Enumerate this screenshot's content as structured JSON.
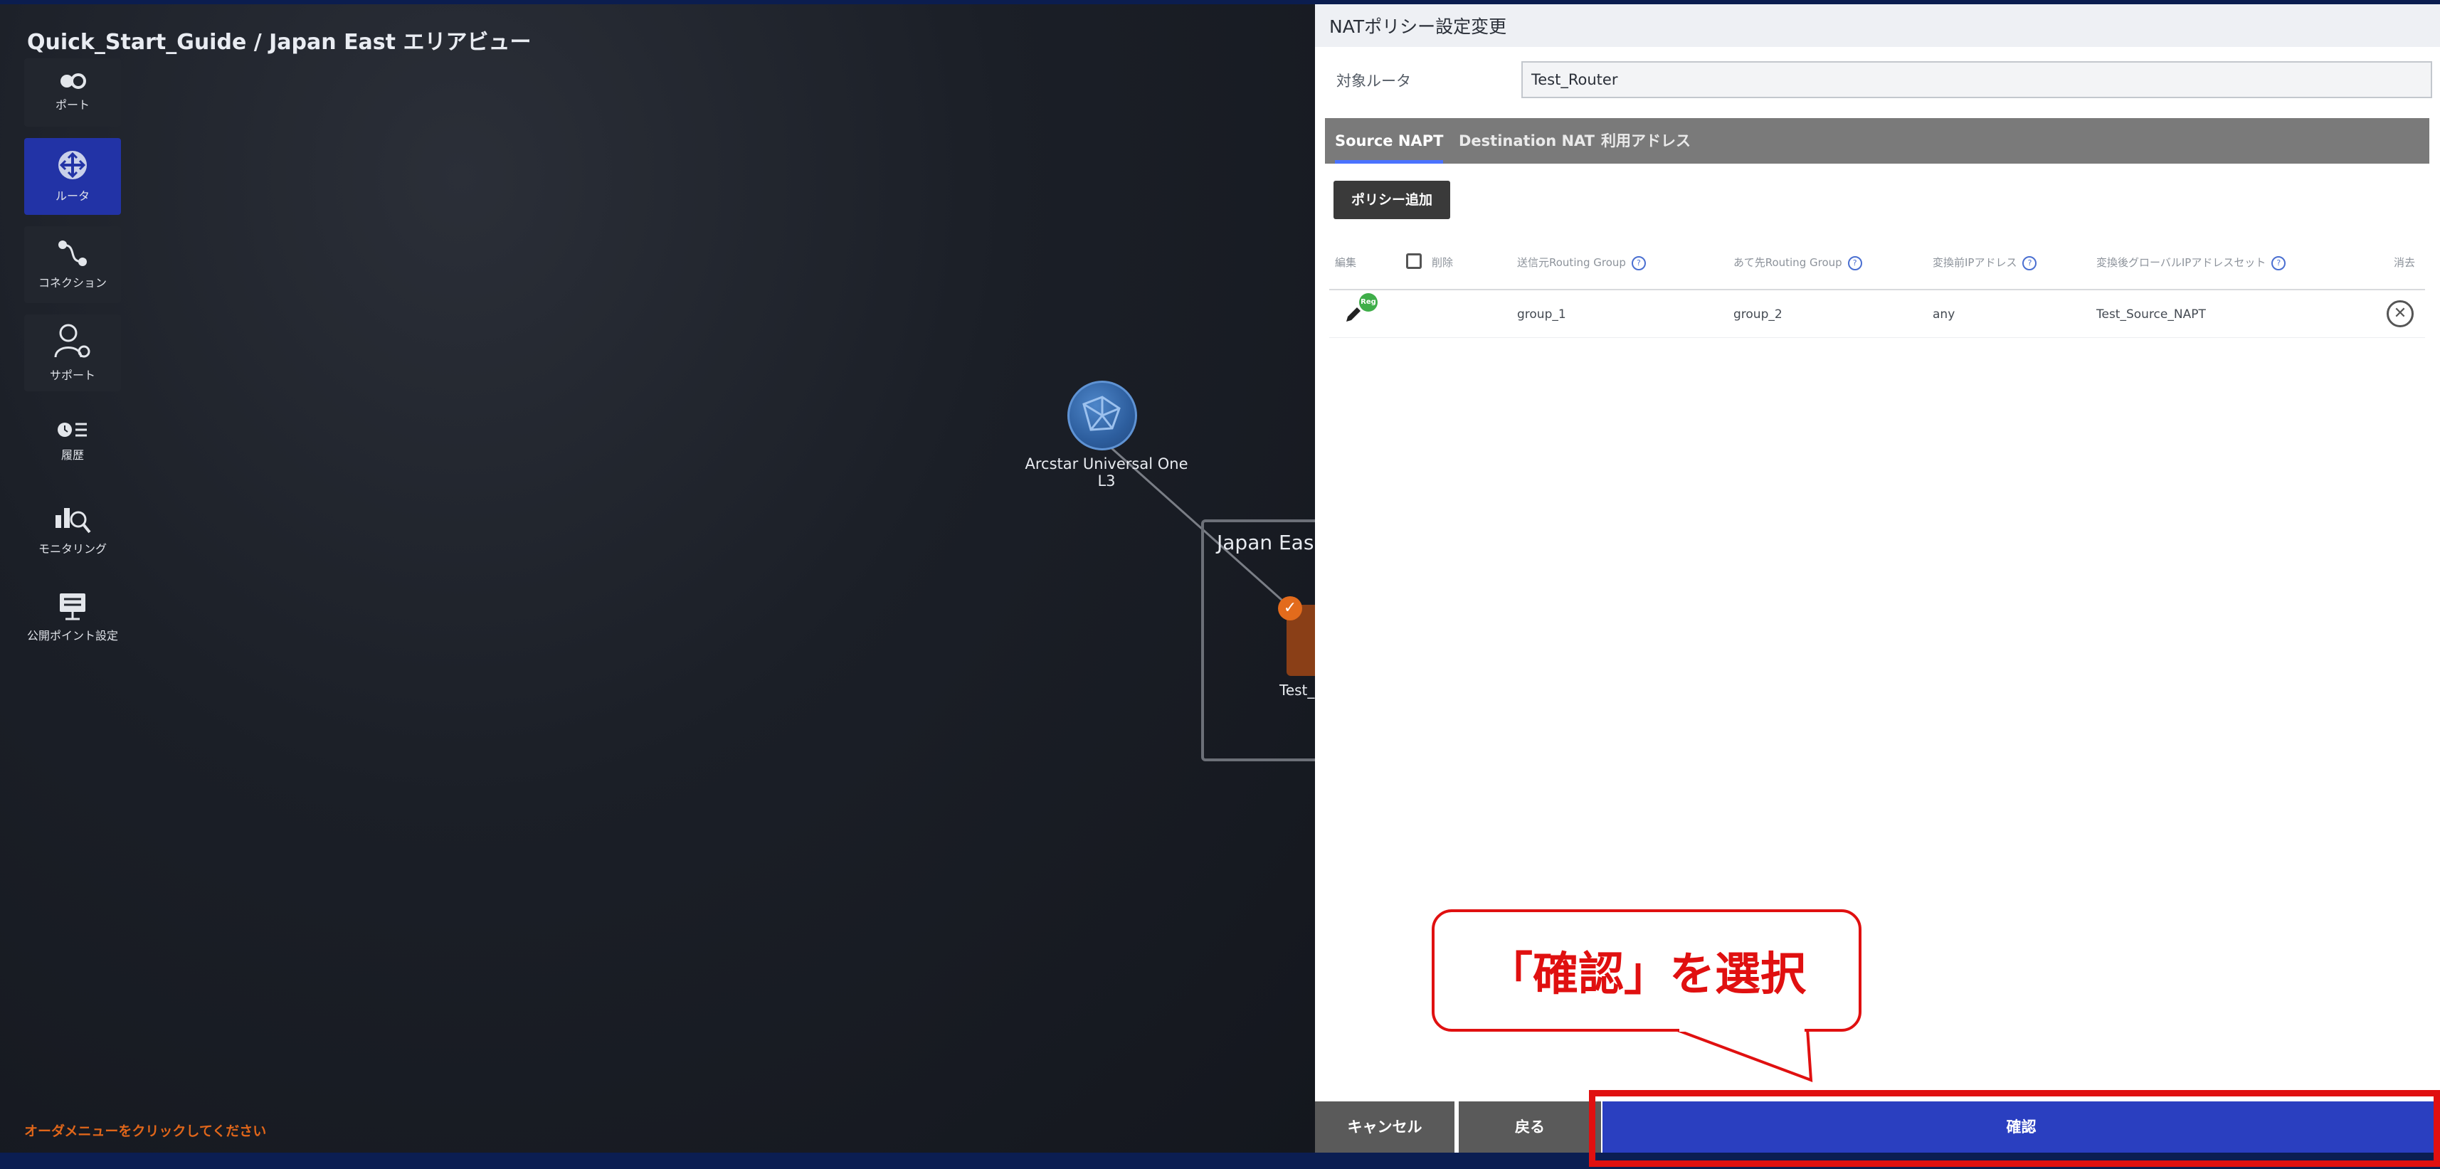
{
  "page_title": "Quick_Start_Guide / Japan East エリアビュー",
  "side_nav": [
    {
      "label": "ポート",
      "icon": "port-icon",
      "active": false
    },
    {
      "label": "ルータ",
      "icon": "router-icon",
      "active": true
    },
    {
      "label": "コネクション",
      "icon": "connection-icon",
      "active": false
    },
    {
      "label": "サポート",
      "icon": "support-icon",
      "active": false
    },
    {
      "label": "履歴",
      "icon": "history-icon",
      "active": false
    },
    {
      "label": "モニタリング",
      "icon": "monitoring-icon",
      "active": false
    },
    {
      "label": "公開ポイント設定",
      "icon": "public-point-icon",
      "active": false
    }
  ],
  "canvas": {
    "cloud_label": "Arcstar Universal One L3",
    "area_label": "Japan Eas",
    "router_label": "Test_"
  },
  "footer_hint": "オーダメニューをクリックしてください",
  "panel": {
    "title": "NATポリシー設定変更",
    "target_router_label": "対象ルータ",
    "target_router_value": "Test_Router",
    "tabs": [
      "Source NAPT",
      "Destination NAT",
      "利用アドレス"
    ],
    "add_button": "ポリシー追加",
    "table": {
      "headers": [
        "編集",
        "削除",
        "送信元Routing Group",
        "あて先Routing Group",
        "変換前IPアドレス",
        "変換後グローバルIPアドレスセット",
        "消去"
      ],
      "rows": [
        {
          "badge": "Reg",
          "from_group": "group_1",
          "to_group": "group_2",
          "before_ip": "any",
          "after_set": "Test_Source_NAPT"
        }
      ]
    },
    "buttons": {
      "cancel": "キャンセル",
      "back": "戻る",
      "confirm": "確認"
    }
  },
  "callout": "「確認」を選択",
  "colors": {
    "accent_blue": "#2a3fc0",
    "highlight_red": "#e01010",
    "reg_green": "#3fae49"
  }
}
